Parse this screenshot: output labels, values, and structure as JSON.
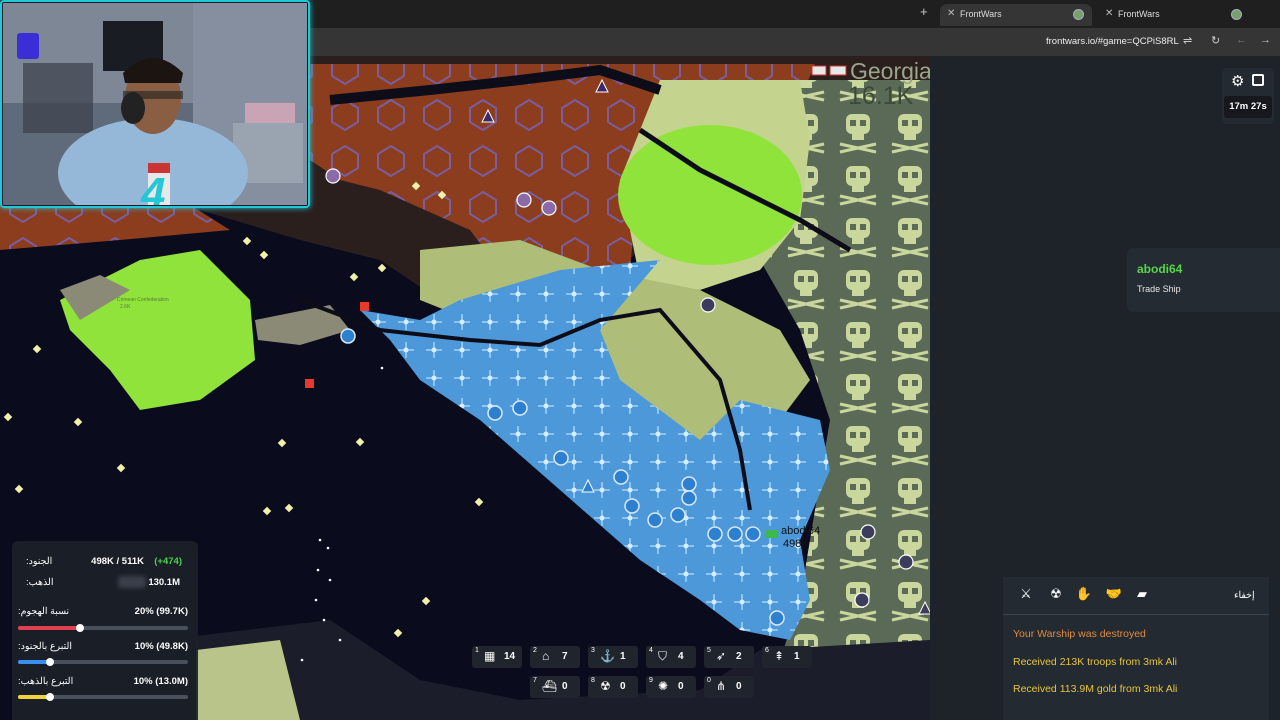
{
  "browser": {
    "tabs": [
      {
        "title": "FrontWars",
        "active": true
      },
      {
        "title": "FrontWars",
        "active": false
      }
    ],
    "url": "frontwars.io/#game=QCPiS8RL",
    "new_tab_icon": "plus-icon",
    "close_icon": "close-icon"
  },
  "map": {
    "country_name": "Georgia",
    "country_troops": "16.1K",
    "player_label": "abodi64",
    "player_troops": "498K",
    "small_label": "Crimean Confederation",
    "small_value": "2.6K"
  },
  "hud": {
    "timer": "17m 27s",
    "settings_icon": "gear-icon",
    "exit_icon": "exit-icon"
  },
  "player_info": {
    "name": "abodi64",
    "unit": "Trade Ship"
  },
  "events": {
    "hide_label": "إخفاء",
    "filter_icons": [
      "sword-icon",
      "nuke-icon",
      "donate-icon",
      "handshake-icon",
      "chat-icon"
    ],
    "messages": [
      {
        "text": "Your Warship was destroyed",
        "color": "#e08c3c"
      },
      {
        "text": "Received 213K troops from 3mk Ali",
        "color": "#e8c43a"
      },
      {
        "text": "Received 113.9M gold from 3mk Ali",
        "color": "#e8c43a"
      }
    ]
  },
  "stats": {
    "troops_label": ":الجنود",
    "troops_value": "498K / 511K",
    "troops_delta": "(+474)",
    "gold_label": ":الذهب",
    "gold_value": "130.1M",
    "attack_label": ":نسبة الهجوم",
    "attack_value": "20% (99.7K)",
    "attack_ratio": 0.2,
    "troop_donate_label": ":التبرع بالجنود",
    "troop_donate_value": "10% (49.8K)",
    "troop_donate_ratio": 0.1,
    "gold_donate_label": ":التبرع بالذهب",
    "gold_donate_value": "10% (13.0M)",
    "gold_donate_ratio": 0.1,
    "colors": {
      "attack": "#e0414f",
      "troops": "#3a8ef0",
      "gold": "#f0d33a",
      "delta": "#4cd14c"
    }
  },
  "build_bar": [
    {
      "key": "1",
      "icon": "city-icon",
      "count": "14"
    },
    {
      "key": "2",
      "icon": "factory-icon",
      "count": "7"
    },
    {
      "key": "3",
      "icon": "port-icon",
      "count": "1"
    },
    {
      "key": "4",
      "icon": "defense-post-icon",
      "count": "4"
    },
    {
      "key": "5",
      "icon": "missile-silo-icon",
      "count": "2"
    },
    {
      "key": "6",
      "icon": "sam-launcher-icon",
      "count": "1"
    },
    {
      "key": "7",
      "icon": "warship-icon",
      "count": "0"
    },
    {
      "key": "8",
      "icon": "atom-bomb-icon",
      "count": "0"
    },
    {
      "key": "9",
      "icon": "hydrogen-bomb-icon",
      "count": "0"
    },
    {
      "key": "0",
      "icon": "mirv-icon",
      "count": "0"
    }
  ],
  "webcam": {
    "logo_text": "4"
  }
}
